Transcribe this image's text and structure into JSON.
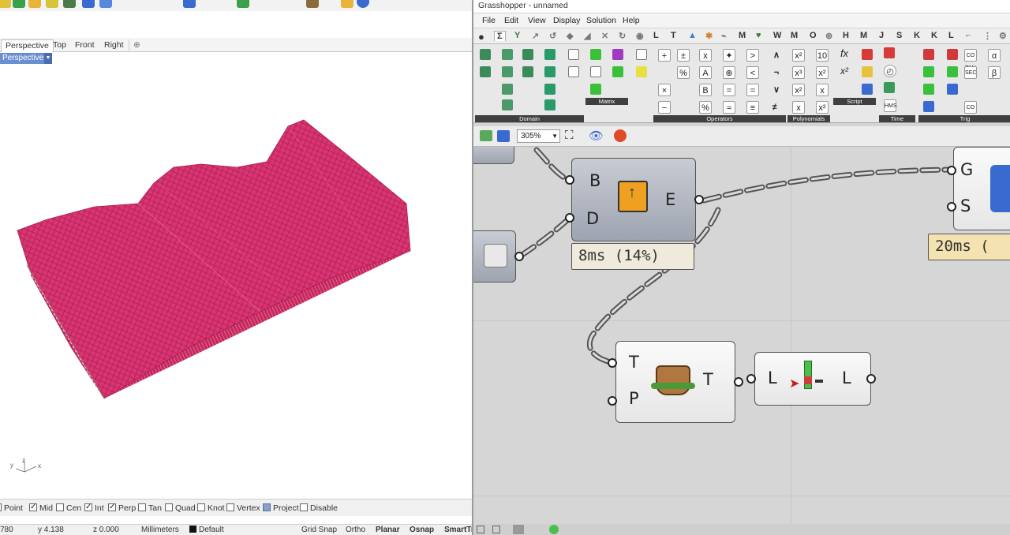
{
  "rhino": {
    "viewport_tabs": [
      "Perspective",
      "Top",
      "Front",
      "Right"
    ],
    "add_tab_symbol": "⊕",
    "viewport_label": "Perspective",
    "axis": {
      "x": "x",
      "y": "y",
      "z": "z"
    },
    "osnaps": [
      {
        "label": "Point",
        "state": "unchecked"
      },
      {
        "label": "Mid",
        "state": "checked"
      },
      {
        "label": "Cen",
        "state": "unchecked"
      },
      {
        "label": "Int",
        "state": "checked"
      },
      {
        "label": "Perp",
        "state": "checked"
      },
      {
        "label": "Tan",
        "state": "unchecked"
      },
      {
        "label": "Quad",
        "state": "unchecked"
      },
      {
        "label": "Knot",
        "state": "unchecked"
      },
      {
        "label": "Vertex",
        "state": "unchecked"
      },
      {
        "label": "Project",
        "state": "filled"
      },
      {
        "label": "Disable",
        "state": "unchecked"
      }
    ],
    "status": {
      "x": "780",
      "y": "y 4.138",
      "z": "z 0.000",
      "units": "Millimeters",
      "layer": "Default",
      "grid_snap": "Grid Snap",
      "ortho": "Ortho",
      "planar": "Planar",
      "osnap": "Osnap",
      "smarttrack": "SmartTr"
    },
    "surface_color": "#d9306f"
  },
  "gh": {
    "title": "Grasshopper - unnamed",
    "menu": [
      "File",
      "Edit",
      "View",
      "Display",
      "Solution",
      "Help"
    ],
    "tabs": [
      "L",
      "T",
      "M",
      "W",
      "M",
      "H",
      "M",
      "J",
      "S",
      "K",
      "K",
      "L"
    ],
    "panels": [
      "Domain",
      "Matrix",
      "Operators",
      "Polynomials",
      "Script",
      "Time",
      "Trig"
    ],
    "zoom": "305%",
    "components": {
      "boundary": {
        "inputs": [
          "B",
          "D"
        ],
        "output": "E",
        "timer": "8ms (14%)"
      },
      "right_comp": {
        "inputs": [
          "G",
          "S"
        ],
        "timer": "20ms ("
      },
      "trim": {
        "inputs": [
          "T",
          "P"
        ],
        "output": "T"
      },
      "length": {
        "input": "L",
        "output": "L"
      }
    }
  }
}
